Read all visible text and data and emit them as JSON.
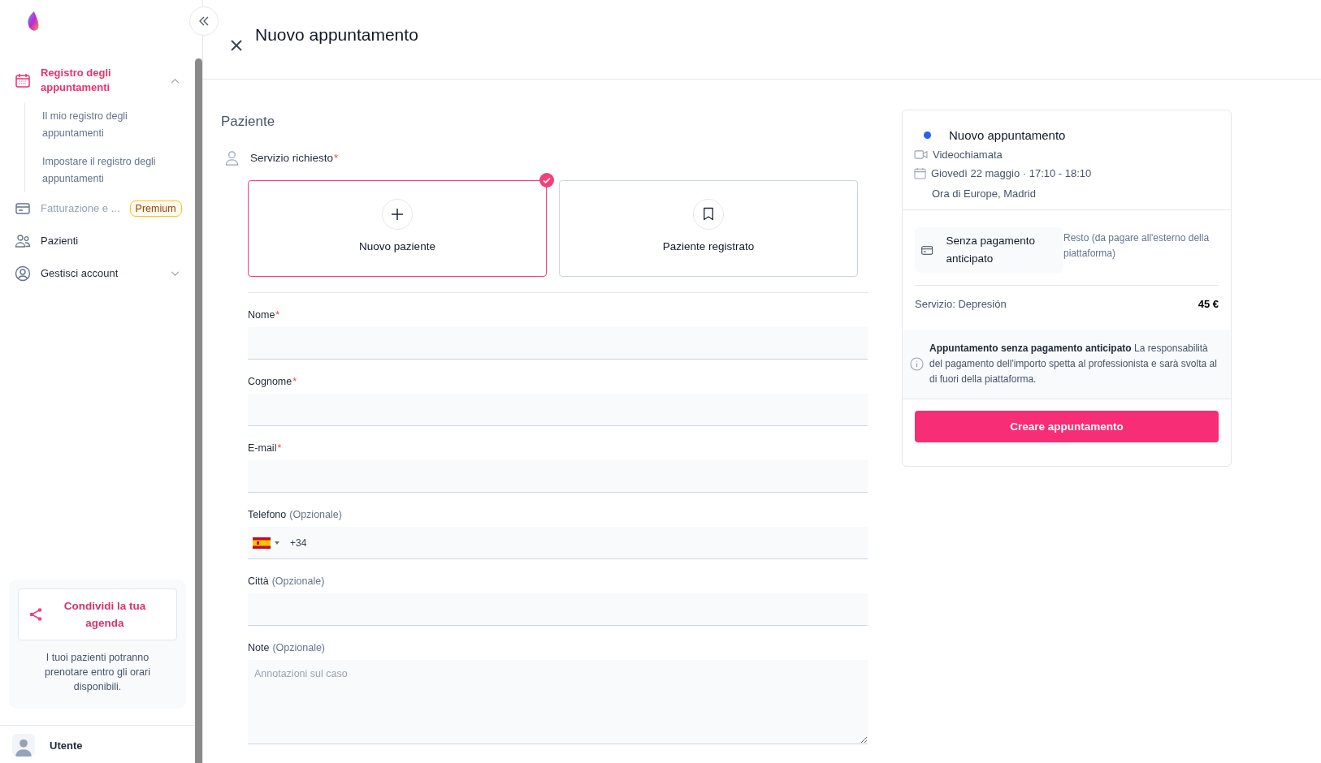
{
  "sidebar": {
    "items": [
      {
        "kind": "group",
        "label": "Registro degli appuntamenti",
        "selected": true,
        "expanded": true,
        "children": [
          {
            "label": "Il mio registro degli appuntamenti"
          },
          {
            "label": "Impostare il registro degli appuntamenti"
          }
        ]
      },
      {
        "kind": "badge",
        "label": "Fatturazione e ...",
        "badge": "Premium",
        "disabled": true
      },
      {
        "kind": "item",
        "label": "Pazienti"
      },
      {
        "kind": "group",
        "label": "Gestisci account",
        "selected": false,
        "expanded": false
      }
    ],
    "share": {
      "button": "Condividi la tua agenda",
      "text": "I tuoi pazienti potranno prenotare entro gli orari disponibili."
    },
    "user": {
      "name": "Utente"
    }
  },
  "header": {
    "title": "Nuovo appuntamento"
  },
  "form": {
    "section": "Paziente",
    "service_label": "Servizio richiesto",
    "service_required_mark": "*",
    "options": [
      {
        "label": "Nuovo paziente",
        "kind": "new",
        "selected": true
      },
      {
        "label": "Paziente registrato",
        "kind": "registered",
        "selected": false
      }
    ],
    "fields": [
      {
        "kind": "text",
        "label": "Nome",
        "required_mark": "*"
      },
      {
        "kind": "text",
        "label": "Cognome",
        "required_mark": "*"
      },
      {
        "kind": "text",
        "label": "E-mail",
        "required_mark": "*"
      },
      {
        "kind": "phone",
        "label": "Telefono",
        "optional": "(Opzionale)",
        "value": "+34"
      },
      {
        "kind": "text",
        "label": "Città",
        "optional": "(Opzionale)"
      },
      {
        "kind": "textarea",
        "label": "Note",
        "optional": "(Opzionale)",
        "placeholder": "Annotazioni sul caso"
      }
    ]
  },
  "summary": {
    "title": "Nuovo appuntamento",
    "call_type": "Videochiamata",
    "date": "Giovedì 22 maggio · 17:10 - 18:10",
    "timezone": "Ora di Europe, Madrid",
    "payment": {
      "method": "Senza pagamento anticipato",
      "note": "Resto (da pagare all'esterno della piattaforma)"
    },
    "service": "Servizio: Depresión",
    "price": "45 €",
    "info": "**Appuntamento senza pagamento anticipato** La responsabilità del pagamento dell'importo spetta al professionista e sarà svolta al di fuori della piattaforma.",
    "button": "Creare appuntamento"
  }
}
